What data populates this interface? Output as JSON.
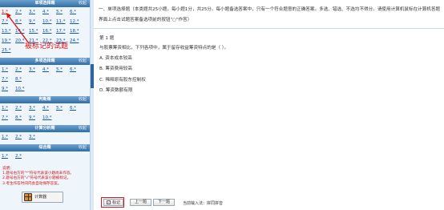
{
  "left_panel": {
    "sections": {
      "single": {
        "title": "单项选择题",
        "collapse": "收起",
        "rows": [
          [
            "1.*",
            "2.*",
            "3.*",
            "4.*",
            "5.*",
            "6.*"
          ],
          [
            "7.*",
            "8.*",
            "9.*",
            "10.*",
            "11.*",
            "12.*"
          ],
          [
            "13.*",
            "14.*",
            "15.*",
            "16.*",
            "17.*",
            "18.*"
          ],
          [
            "19.*",
            "20.*",
            "21.*",
            "22.*",
            "23.*",
            "24.*"
          ],
          [
            "25.*"
          ]
        ],
        "marked_index": 0
      },
      "multi": {
        "title": "多项选择题",
        "collapse": "收起",
        "rows": [
          [
            "1.*",
            "2.*",
            "3.*",
            "4.*",
            "5.*",
            "6.*"
          ],
          [
            "7.*",
            "8.*"
          ],
          [
            "9.*",
            "10.*"
          ]
        ]
      },
      "judge": {
        "title": "判断题",
        "collapse": "收起",
        "rows": [
          [
            "1.*",
            "2.*",
            "3.*",
            "4.*",
            "5.*",
            "6.*"
          ],
          [
            "7.*",
            "8.*",
            "9.*",
            "10.*"
          ]
        ]
      },
      "calc": {
        "title": "计算分析题",
        "collapse": "收起",
        "rows": [
          [
            "1.*",
            "2.*",
            "3.*"
          ]
        ]
      },
      "comp": {
        "title": "综合题",
        "collapse": "收起",
        "rows": [
          [
            "1.*",
            "2.*"
          ]
        ]
      }
    },
    "notes": [
      "说明：",
      "1.题号右方的\"*\"符号代表该小题尚未作答。",
      "2.题号右方的\"√\"符号代表该小题被标记。",
      "3.考生作答时间内会自动保存答案。"
    ],
    "calculator_label": "计算器",
    "annotation": "被标记的试题"
  },
  "main": {
    "instructions": "一、单项选择题（本类题共25小题，每小题1分，共25分。每小题备选答案中，只有一个符合题意的正确答案。多选、错选、不选均不得分。请使用计算机鼠标在计算机答题界面上点击试题答案备选项前的按钮\"○\"作答）",
    "question_title": "第 1 题",
    "question_text": "与股票筹资相比，下列各项中，属于留存收益筹资特点的是（    ）。",
    "options": [
      {
        "letter": "A.",
        "text": "资本成本较高"
      },
      {
        "letter": "B.",
        "text": "筹资费用较高"
      },
      {
        "letter": "C.",
        "text": "稀释原有股东控制权"
      },
      {
        "letter": "D.",
        "text": "筹资数额有限"
      }
    ]
  },
  "bottom": {
    "mark_label": "标记",
    "prev_label": "上一题",
    "next_label": "下一题",
    "ime_text": "当前输入法：拼同拼音"
  }
}
